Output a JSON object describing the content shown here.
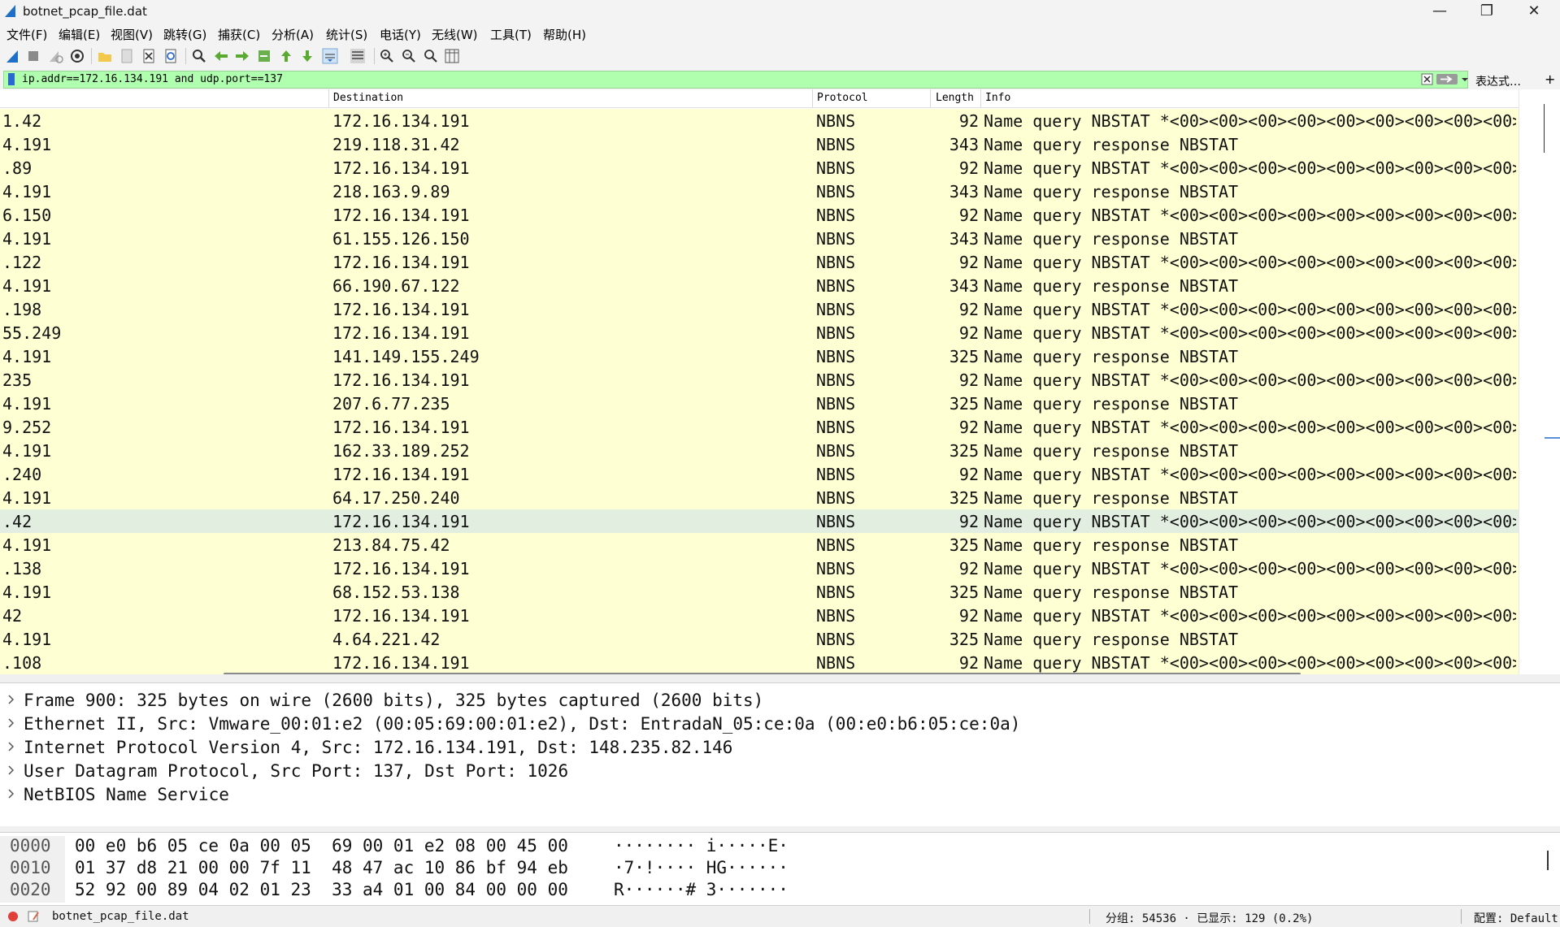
{
  "window": {
    "title": "botnet_pcap_file.dat"
  },
  "menu": [
    "文件(F)",
    "编辑(E)",
    "视图(V)",
    "跳转(G)",
    "捕获(C)",
    "分析(A)",
    "统计(S)",
    "电话(Y)",
    "无线(W)",
    "工具(T)",
    "帮助(H)"
  ],
  "toolbar": {
    "icons": [
      "shark-fin-start-icon",
      "stop-icon",
      "restart-icon",
      "capture-options-icon",
      "open-file-icon",
      "save-file-icon",
      "close-file-icon",
      "reload-icon",
      "find-icon",
      "go-back-icon",
      "go-forward-icon",
      "go-to-packet-icon",
      "first-packet-icon",
      "last-packet-icon",
      "autoscroll-icon",
      "colorize-icon",
      "zoom-in-icon",
      "zoom-out-icon",
      "zoom-normal-icon",
      "resize-columns-icon"
    ]
  },
  "filter": {
    "value": "ip.addr==172.16.134.191 and udp.port==137",
    "expression_label": "表达式…",
    "plus_label": "+",
    "bg_color": "#afffaf"
  },
  "packet_list": {
    "columns": {
      "destination": "Destination",
      "protocol": "Protocol",
      "length": "Length",
      "info": "Info"
    },
    "row_color": "#ffffd4",
    "selected_row_color": "#e2efe0",
    "rows": [
      {
        "src": "1.42",
        "dst": "172.16.134.191",
        "proto": "NBNS",
        "len": "92",
        "info": "Name query NBSTAT *<00><00><00><00><00><00><00><00><00>"
      },
      {
        "src": "4.191",
        "dst": "219.118.31.42",
        "proto": "NBNS",
        "len": "343",
        "info": "Name query response NBSTAT"
      },
      {
        "src": ".89",
        "dst": "172.16.134.191",
        "proto": "NBNS",
        "len": "92",
        "info": "Name query NBSTAT *<00><00><00><00><00><00><00><00><00>"
      },
      {
        "src": "4.191",
        "dst": "218.163.9.89",
        "proto": "NBNS",
        "len": "343",
        "info": "Name query response NBSTAT"
      },
      {
        "src": "6.150",
        "dst": "172.16.134.191",
        "proto": "NBNS",
        "len": "92",
        "info": "Name query NBSTAT *<00><00><00><00><00><00><00><00><00>"
      },
      {
        "src": "4.191",
        "dst": "61.155.126.150",
        "proto": "NBNS",
        "len": "343",
        "info": "Name query response NBSTAT"
      },
      {
        "src": ".122",
        "dst": "172.16.134.191",
        "proto": "NBNS",
        "len": "92",
        "info": "Name query NBSTAT *<00><00><00><00><00><00><00><00><00>"
      },
      {
        "src": "4.191",
        "dst": "66.190.67.122",
        "proto": "NBNS",
        "len": "343",
        "info": "Name query response NBSTAT"
      },
      {
        "src": ".198",
        "dst": "172.16.134.191",
        "proto": "NBNS",
        "len": "92",
        "info": "Name query NBSTAT *<00><00><00><00><00><00><00><00><00>"
      },
      {
        "src": "55.249",
        "dst": "172.16.134.191",
        "proto": "NBNS",
        "len": "92",
        "info": "Name query NBSTAT *<00><00><00><00><00><00><00><00><00>"
      },
      {
        "src": "4.191",
        "dst": "141.149.155.249",
        "proto": "NBNS",
        "len": "325",
        "info": "Name query response NBSTAT"
      },
      {
        "src": "235",
        "dst": "172.16.134.191",
        "proto": "NBNS",
        "len": "92",
        "info": "Name query NBSTAT *<00><00><00><00><00><00><00><00><00>"
      },
      {
        "src": "4.191",
        "dst": "207.6.77.235",
        "proto": "NBNS",
        "len": "325",
        "info": "Name query response NBSTAT"
      },
      {
        "src": "9.252",
        "dst": "172.16.134.191",
        "proto": "NBNS",
        "len": "92",
        "info": "Name query NBSTAT *<00><00><00><00><00><00><00><00><00>"
      },
      {
        "src": "4.191",
        "dst": "162.33.189.252",
        "proto": "NBNS",
        "len": "325",
        "info": "Name query response NBSTAT"
      },
      {
        "src": ".240",
        "dst": "172.16.134.191",
        "proto": "NBNS",
        "len": "92",
        "info": "Name query NBSTAT *<00><00><00><00><00><00><00><00><00>"
      },
      {
        "src": "4.191",
        "dst": "64.17.250.240",
        "proto": "NBNS",
        "len": "325",
        "info": "Name query response NBSTAT"
      },
      {
        "src": ".42",
        "dst": "172.16.134.191",
        "proto": "NBNS",
        "len": "92",
        "info": "Name query NBSTAT *<00><00><00><00><00><00><00><00><00>",
        "selected": true
      },
      {
        "src": "4.191",
        "dst": "213.84.75.42",
        "proto": "NBNS",
        "len": "325",
        "info": "Name query response NBSTAT"
      },
      {
        "src": ".138",
        "dst": "172.16.134.191",
        "proto": "NBNS",
        "len": "92",
        "info": "Name query NBSTAT *<00><00><00><00><00><00><00><00><00>"
      },
      {
        "src": "4.191",
        "dst": "68.152.53.138",
        "proto": "NBNS",
        "len": "325",
        "info": "Name query response NBSTAT"
      },
      {
        "src": "42",
        "dst": "172.16.134.191",
        "proto": "NBNS",
        "len": "92",
        "info": "Name query NBSTAT *<00><00><00><00><00><00><00><00><00>"
      },
      {
        "src": "4.191",
        "dst": "4.64.221.42",
        "proto": "NBNS",
        "len": "325",
        "info": "Name query response NBSTAT"
      },
      {
        "src": ".108",
        "dst": "172.16.134.191",
        "proto": "NBNS",
        "len": "92",
        "info": "Name query NBSTAT *<00><00><00><00><00><00><00><00><00>"
      }
    ]
  },
  "details": [
    "Frame 900: 325 bytes on wire (2600 bits), 325 bytes captured (2600 bits)",
    "Ethernet II, Src: Vmware_00:01:e2 (00:05:69:00:01:e2), Dst: EntradaN_05:ce:0a (00:e0:b6:05:ce:0a)",
    "Internet Protocol Version 4, Src: 172.16.134.191, Dst: 148.235.82.146",
    "User Datagram Protocol, Src Port: 137, Dst Port: 1026",
    "NetBIOS Name Service"
  ],
  "hex": [
    {
      "offset": "0000",
      "bytes": "00 e0 b6 05 ce 0a 00 05  69 00 01 e2 08 00 45 00",
      "ascii": "········ i·····E·"
    },
    {
      "offset": "0010",
      "bytes": "01 37 d8 21 00 00 7f 11  48 47 ac 10 86 bf 94 eb",
      "ascii": "·7·!···· HG······"
    },
    {
      "offset": "0020",
      "bytes": "52 92 00 89 04 02 01 23  33 a4 01 00 84 00 00 00",
      "ascii": "R······# 3·······"
    }
  ],
  "status": {
    "file": "botnet_pcap_file.dat",
    "packets": "分组: 54536 · 已显示: 129 (0.2%)",
    "profile": "配置: Default"
  }
}
